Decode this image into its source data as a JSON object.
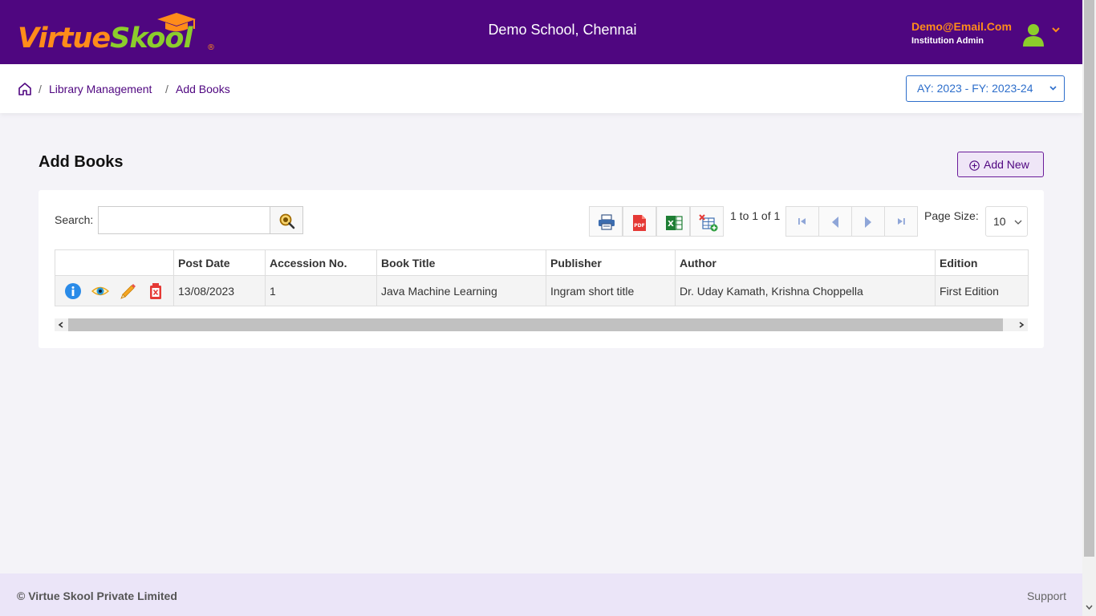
{
  "header": {
    "logo": {
      "part1": "Virtue",
      "part2": "Skool",
      "reg": "®"
    },
    "school_name": "Demo School, Chennai",
    "user_email": "Demo@Email.Com",
    "user_role": "Institution Admin"
  },
  "breadcrumb": {
    "items": [
      "Library Management",
      "Add Books"
    ],
    "separator": "/"
  },
  "academic_year": "AY: 2023 - FY: 2023-24",
  "page": {
    "title": "Add Books",
    "add_new_label": "Add New"
  },
  "search": {
    "label": "Search:",
    "value": "",
    "placeholder": ""
  },
  "toolbar": {
    "icons": [
      "print-icon",
      "pdf-icon",
      "excel-icon",
      "column-chooser-icon"
    ]
  },
  "pagination": {
    "summary": "1 to 1 of 1",
    "page_size_label": "Page Size:",
    "page_size": "10"
  },
  "table": {
    "columns": [
      "",
      "Post Date",
      "Accession No.",
      "Book Title",
      "Publisher",
      "Author",
      "Edition"
    ],
    "rows": [
      {
        "post_date": "13/08/2023",
        "accession_no": "1",
        "book_title": "Java Machine Learning",
        "publisher": "Ingram short title",
        "author": "Dr. Uday Kamath, Krishna Choppella",
        "edition": "First Edition"
      }
    ]
  },
  "footer": {
    "copyright": "© Virtue Skool Private Limited",
    "support": "Support"
  },
  "colors": {
    "brand_purple": "#4f0680",
    "brand_orange": "#ff8c1a",
    "brand_green": "#8ccd2c",
    "link_blue": "#2d6ecb"
  }
}
